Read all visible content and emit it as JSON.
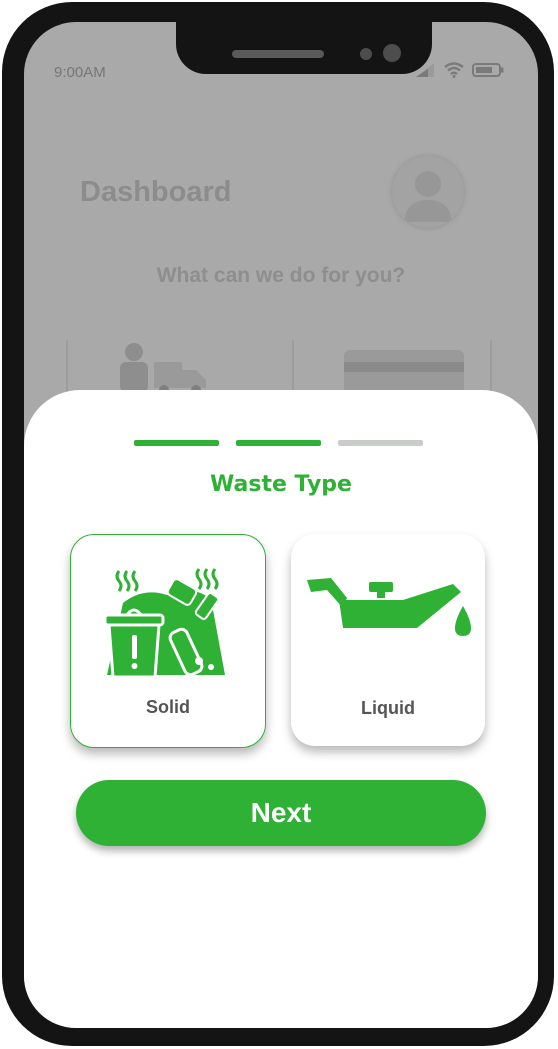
{
  "status_bar": {
    "time": "9:00AM",
    "icons": [
      "signal-icon",
      "wifi-icon",
      "battery-icon"
    ]
  },
  "background": {
    "title": "Dashboard",
    "question": "What can we do for you?",
    "tiles": [
      {
        "icon": "delivery-truck-icon"
      },
      {
        "icon": "payment-card-icon"
      }
    ]
  },
  "sheet": {
    "progress": {
      "total_steps": 3,
      "completed_steps": 2
    },
    "title": "Waste Type",
    "options": [
      {
        "label": "Solid",
        "icon": "solid-waste-icon",
        "selected": true
      },
      {
        "label": "Liquid",
        "icon": "oil-can-icon",
        "selected": false
      }
    ],
    "next_label": "Next"
  },
  "colors": {
    "accent": "#2eb135",
    "inactive_step": "#c9ccc9",
    "overlay": "#a9a9a9"
  }
}
